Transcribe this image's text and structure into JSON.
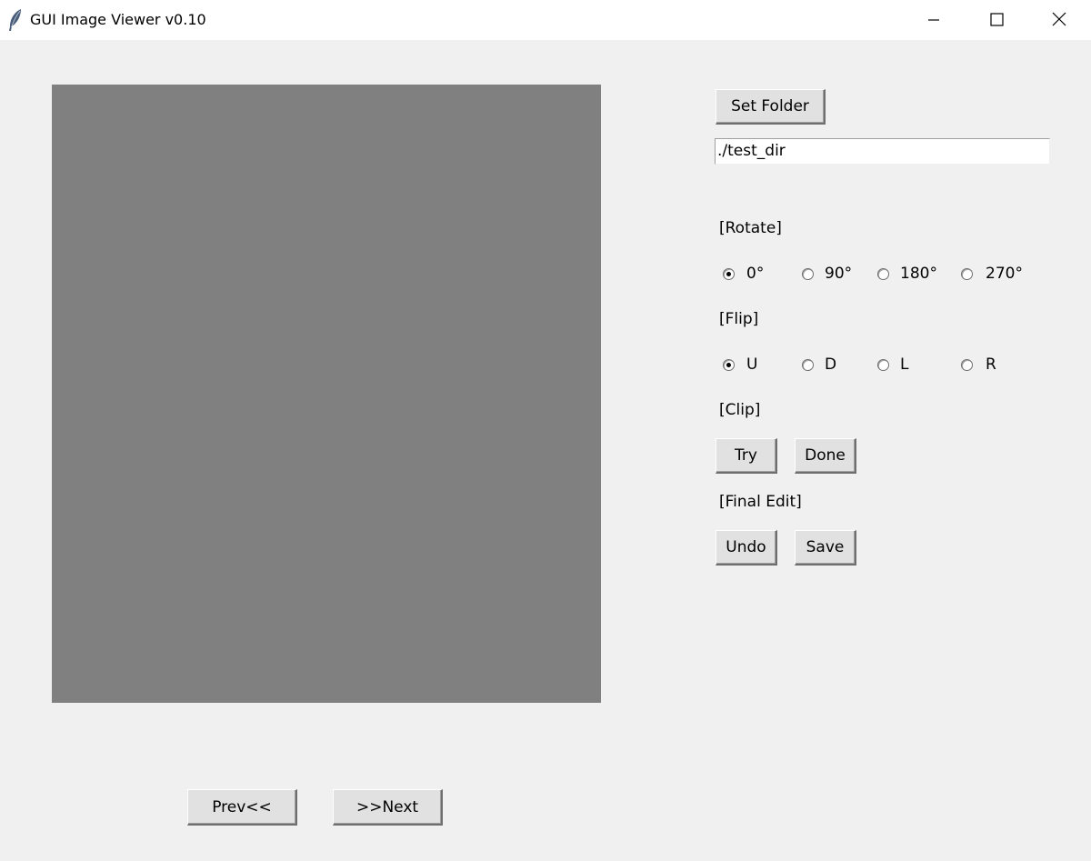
{
  "window": {
    "title": "GUI Image Viewer v0.10"
  },
  "folder": {
    "button_label": "Set Folder",
    "path_value": "./test_dir"
  },
  "rotate": {
    "label": "[Rotate]",
    "options": [
      "0°",
      "90°",
      "180°",
      "270°"
    ],
    "selected": "0°"
  },
  "flip": {
    "label": "[Flip]",
    "options": [
      "U",
      "D",
      "L",
      "R"
    ],
    "selected": "U"
  },
  "clip": {
    "label": "[Clip]",
    "try_label": "Try",
    "done_label": "Done"
  },
  "final_edit": {
    "label": "[Final Edit]",
    "undo_label": "Undo",
    "save_label": "Save"
  },
  "navigation": {
    "prev_label": "Prev<<",
    "next_label": ">>Next"
  },
  "colors": {
    "canvas_background": "#808080",
    "window_background": "#f0f0f0"
  },
  "icons": {
    "app": "feather-icon",
    "minimize": "minimize-icon",
    "maximize": "maximize-icon",
    "close": "close-icon"
  }
}
